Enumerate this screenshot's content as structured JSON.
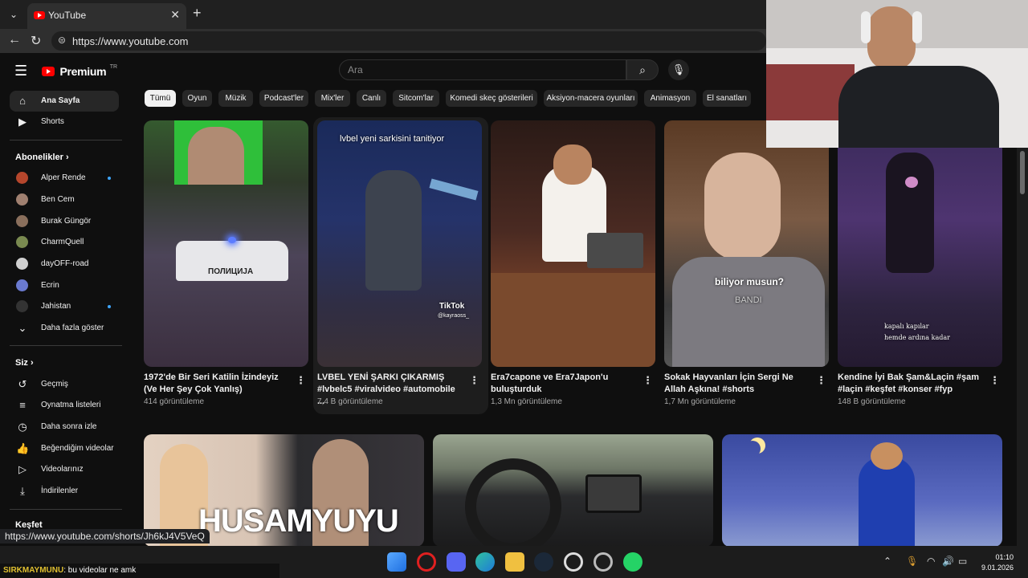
{
  "browser": {
    "tab_title": "YouTube",
    "url": "https://www.youtube.com"
  },
  "header": {
    "logo_text": "Premium",
    "logo_badge": "TR",
    "search_placeholder": "Ara"
  },
  "sidebar": {
    "main": [
      {
        "label": "Ana Sayfa",
        "icon": "home-icon"
      },
      {
        "label": "Shorts",
        "icon": "shorts-icon"
      }
    ],
    "subscriptions_heading": "Abonelikler",
    "subscriptions": [
      {
        "label": "Alper Rende",
        "new": true,
        "color": "#b5462c"
      },
      {
        "label": "Ben Cem",
        "new": false,
        "color": "#a08070"
      },
      {
        "label": "Burak Güngör",
        "new": false,
        "color": "#8a6f5c"
      },
      {
        "label": "CharmQuell",
        "new": false,
        "color": "#7a8a50"
      },
      {
        "label": "dayOFF-road",
        "new": false,
        "color": "#d0d0d0"
      },
      {
        "label": "Ecrin",
        "new": false,
        "color": "#6a7ad0"
      },
      {
        "label": "Jahistan",
        "new": true,
        "color": "#333333"
      }
    ],
    "show_more": "Daha fazla göster",
    "you_heading": "Siz",
    "you": [
      {
        "label": "Geçmiş",
        "icon": "history-icon"
      },
      {
        "label": "Oynatma listeleri",
        "icon": "playlists-icon"
      },
      {
        "label": "Daha sonra izle",
        "icon": "watch-later-icon"
      },
      {
        "label": "Beğendiğim videolar",
        "icon": "liked-icon"
      },
      {
        "label": "Videolarınız",
        "icon": "your-videos-icon"
      },
      {
        "label": "İndirilenler",
        "icon": "downloads-icon"
      }
    ],
    "explore_heading": "Keşfet"
  },
  "chips": [
    "Tümü",
    "Oyun",
    "Müzik",
    "Podcast'ler",
    "Mix'ler",
    "Canlı",
    "Sitcom'lar",
    "Komedi skeç gösterileri",
    "Aksiyon-macera oyunları",
    "Animasyon",
    "El sanatları"
  ],
  "shorts": [
    {
      "title": "1972'de Bir Seri Katilin İzindeyiz (Ve Her Şey Çok Yanlış)",
      "views": "414 görüntüleme",
      "overlay": "ПОЛИЦИЈА"
    },
    {
      "title": "LVBEL YENİ ŞARKI ÇIKARMIŞ #lvbelc5 #viralvideo #automobile ...",
      "views": "7,4 B görüntüleme",
      "overlay": "lvbel yeni sarkisini tanitiyor",
      "overlay2": "TikTok",
      "overlay3": "@kayraoss_"
    },
    {
      "title": "Era7capone ve Era7Japon'u buluşturduk",
      "views": "1,3 Mn görüntüleme"
    },
    {
      "title": "Sokak Hayvanları İçin Sergi Ne Allah Aşkına! #shorts",
      "views": "1,7 Mn görüntüleme",
      "overlay": "biliyor musun?",
      "overlay2": "BANDI"
    },
    {
      "title": "Kendine İyi Bak Şam&Laçin #şam #laçin #keşfet #konser #fyp",
      "views": "148 B görüntüleme",
      "overlay": "kapalı kapılar",
      "overlay2": "hemde ardına kadar"
    }
  ],
  "videos": [
    {
      "overlay": "HUSAMYUYU"
    },
    {},
    {}
  ],
  "status_url": "https://www.youtube.com/shorts/Jh6kJ4V5VeQ",
  "chat": {
    "user": "SIRKMAYMUNU",
    "message": ": bu videolar ne amk"
  },
  "clock": {
    "time": "01:10",
    "date": "9.01.2026"
  }
}
